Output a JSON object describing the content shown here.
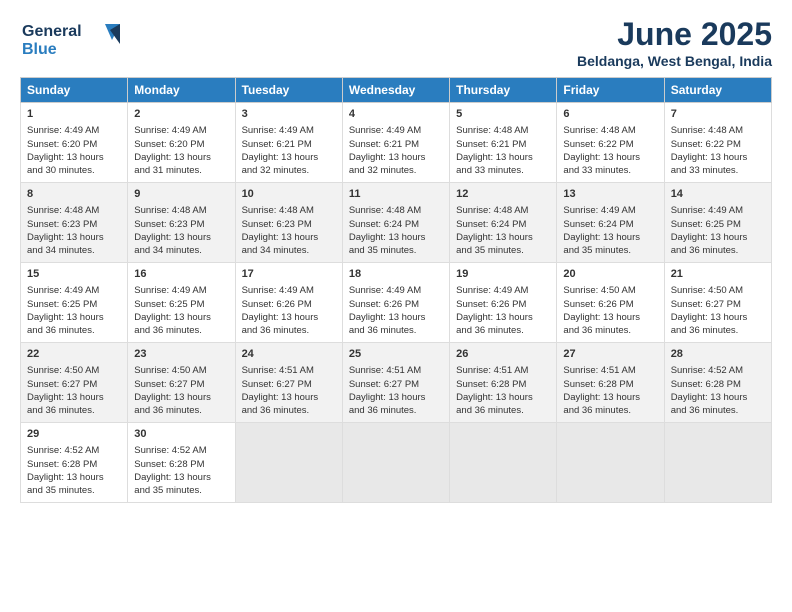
{
  "header": {
    "logo_line1": "General",
    "logo_line2": "Blue",
    "month_year": "June 2025",
    "location": "Beldanga, West Bengal, India"
  },
  "days_of_week": [
    "Sunday",
    "Monday",
    "Tuesday",
    "Wednesday",
    "Thursday",
    "Friday",
    "Saturday"
  ],
  "weeks": [
    [
      {
        "day": "1",
        "info": "Sunrise: 4:49 AM\nSunset: 6:20 PM\nDaylight: 13 hours\nand 30 minutes."
      },
      {
        "day": "2",
        "info": "Sunrise: 4:49 AM\nSunset: 6:20 PM\nDaylight: 13 hours\nand 31 minutes."
      },
      {
        "day": "3",
        "info": "Sunrise: 4:49 AM\nSunset: 6:21 PM\nDaylight: 13 hours\nand 32 minutes."
      },
      {
        "day": "4",
        "info": "Sunrise: 4:49 AM\nSunset: 6:21 PM\nDaylight: 13 hours\nand 32 minutes."
      },
      {
        "day": "5",
        "info": "Sunrise: 4:48 AM\nSunset: 6:21 PM\nDaylight: 13 hours\nand 33 minutes."
      },
      {
        "day": "6",
        "info": "Sunrise: 4:48 AM\nSunset: 6:22 PM\nDaylight: 13 hours\nand 33 minutes."
      },
      {
        "day": "7",
        "info": "Sunrise: 4:48 AM\nSunset: 6:22 PM\nDaylight: 13 hours\nand 33 minutes."
      }
    ],
    [
      {
        "day": "8",
        "info": "Sunrise: 4:48 AM\nSunset: 6:23 PM\nDaylight: 13 hours\nand 34 minutes."
      },
      {
        "day": "9",
        "info": "Sunrise: 4:48 AM\nSunset: 6:23 PM\nDaylight: 13 hours\nand 34 minutes."
      },
      {
        "day": "10",
        "info": "Sunrise: 4:48 AM\nSunset: 6:23 PM\nDaylight: 13 hours\nand 34 minutes."
      },
      {
        "day": "11",
        "info": "Sunrise: 4:48 AM\nSunset: 6:24 PM\nDaylight: 13 hours\nand 35 minutes."
      },
      {
        "day": "12",
        "info": "Sunrise: 4:48 AM\nSunset: 6:24 PM\nDaylight: 13 hours\nand 35 minutes."
      },
      {
        "day": "13",
        "info": "Sunrise: 4:49 AM\nSunset: 6:24 PM\nDaylight: 13 hours\nand 35 minutes."
      },
      {
        "day": "14",
        "info": "Sunrise: 4:49 AM\nSunset: 6:25 PM\nDaylight: 13 hours\nand 36 minutes."
      }
    ],
    [
      {
        "day": "15",
        "info": "Sunrise: 4:49 AM\nSunset: 6:25 PM\nDaylight: 13 hours\nand 36 minutes."
      },
      {
        "day": "16",
        "info": "Sunrise: 4:49 AM\nSunset: 6:25 PM\nDaylight: 13 hours\nand 36 minutes."
      },
      {
        "day": "17",
        "info": "Sunrise: 4:49 AM\nSunset: 6:26 PM\nDaylight: 13 hours\nand 36 minutes."
      },
      {
        "day": "18",
        "info": "Sunrise: 4:49 AM\nSunset: 6:26 PM\nDaylight: 13 hours\nand 36 minutes."
      },
      {
        "day": "19",
        "info": "Sunrise: 4:49 AM\nSunset: 6:26 PM\nDaylight: 13 hours\nand 36 minutes."
      },
      {
        "day": "20",
        "info": "Sunrise: 4:50 AM\nSunset: 6:26 PM\nDaylight: 13 hours\nand 36 minutes."
      },
      {
        "day": "21",
        "info": "Sunrise: 4:50 AM\nSunset: 6:27 PM\nDaylight: 13 hours\nand 36 minutes."
      }
    ],
    [
      {
        "day": "22",
        "info": "Sunrise: 4:50 AM\nSunset: 6:27 PM\nDaylight: 13 hours\nand 36 minutes."
      },
      {
        "day": "23",
        "info": "Sunrise: 4:50 AM\nSunset: 6:27 PM\nDaylight: 13 hours\nand 36 minutes."
      },
      {
        "day": "24",
        "info": "Sunrise: 4:51 AM\nSunset: 6:27 PM\nDaylight: 13 hours\nand 36 minutes."
      },
      {
        "day": "25",
        "info": "Sunrise: 4:51 AM\nSunset: 6:27 PM\nDaylight: 13 hours\nand 36 minutes."
      },
      {
        "day": "26",
        "info": "Sunrise: 4:51 AM\nSunset: 6:28 PM\nDaylight: 13 hours\nand 36 minutes."
      },
      {
        "day": "27",
        "info": "Sunrise: 4:51 AM\nSunset: 6:28 PM\nDaylight: 13 hours\nand 36 minutes."
      },
      {
        "day": "28",
        "info": "Sunrise: 4:52 AM\nSunset: 6:28 PM\nDaylight: 13 hours\nand 36 minutes."
      }
    ],
    [
      {
        "day": "29",
        "info": "Sunrise: 4:52 AM\nSunset: 6:28 PM\nDaylight: 13 hours\nand 35 minutes."
      },
      {
        "day": "30",
        "info": "Sunrise: 4:52 AM\nSunset: 6:28 PM\nDaylight: 13 hours\nand 35 minutes."
      },
      {
        "day": "",
        "info": ""
      },
      {
        "day": "",
        "info": ""
      },
      {
        "day": "",
        "info": ""
      },
      {
        "day": "",
        "info": ""
      },
      {
        "day": "",
        "info": ""
      }
    ]
  ]
}
